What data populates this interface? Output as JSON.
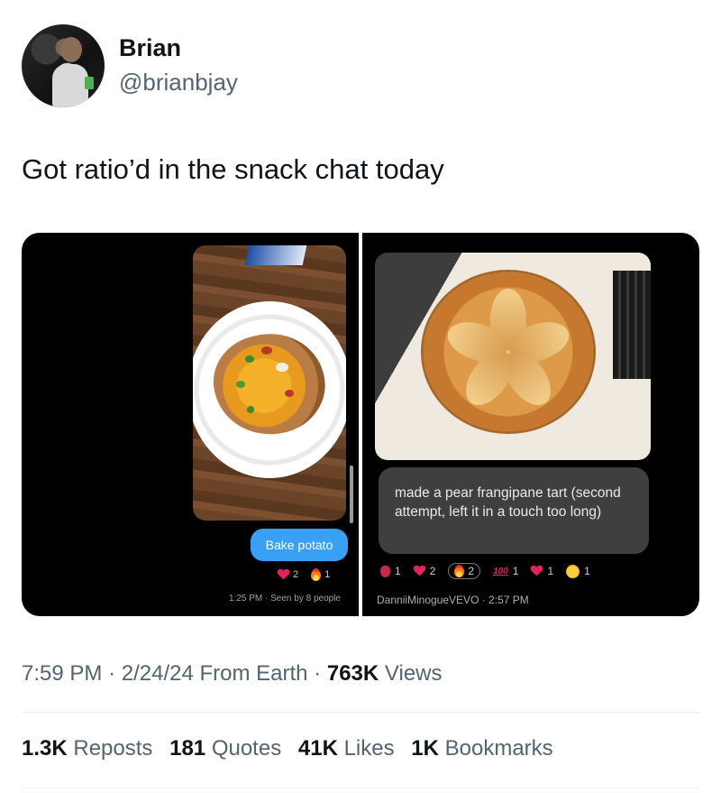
{
  "author": {
    "name": "Brian",
    "handle": "@brianbjay"
  },
  "tweet": {
    "text": "Got ratio’d in the snack chat today"
  },
  "media": {
    "left": {
      "bubble_text": "Bake potato",
      "reactions": [
        {
          "icon": "heart-icon",
          "count": "2"
        },
        {
          "icon": "fire-icon",
          "count": "1"
        }
      ],
      "status": "1:25 PM · Seen by 8 people"
    },
    "right": {
      "bubble_text": "made a pear frangipane tart (second attempt, left it in a touch too long)",
      "reactions": [
        {
          "icon": "anatomical-heart-icon",
          "count": "1"
        },
        {
          "icon": "heart-icon",
          "count": "2"
        },
        {
          "icon": "fire-icon",
          "count": "2"
        },
        {
          "icon": "hundred-points-icon",
          "count": "1"
        },
        {
          "icon": "heart-icon",
          "count": "1"
        },
        {
          "icon": "smiling-face-with-hearts-icon",
          "count": "1"
        }
      ],
      "status": "DanniiMinogueVEVO · 2:57 PM",
      "hundred_glyph": "100"
    }
  },
  "meta": {
    "time": "7:59 PM",
    "separator": "·",
    "date": "2/24/24",
    "source": "From Earth",
    "views_count": "763K",
    "views_label": "Views"
  },
  "stats": {
    "reposts_count": "1.3K",
    "reposts_label": "Reposts",
    "quotes_count": "181",
    "quotes_label": "Quotes",
    "likes_count": "41K",
    "likes_label": "Likes",
    "bookmarks_count": "1K",
    "bookmarks_label": "Bookmarks"
  }
}
